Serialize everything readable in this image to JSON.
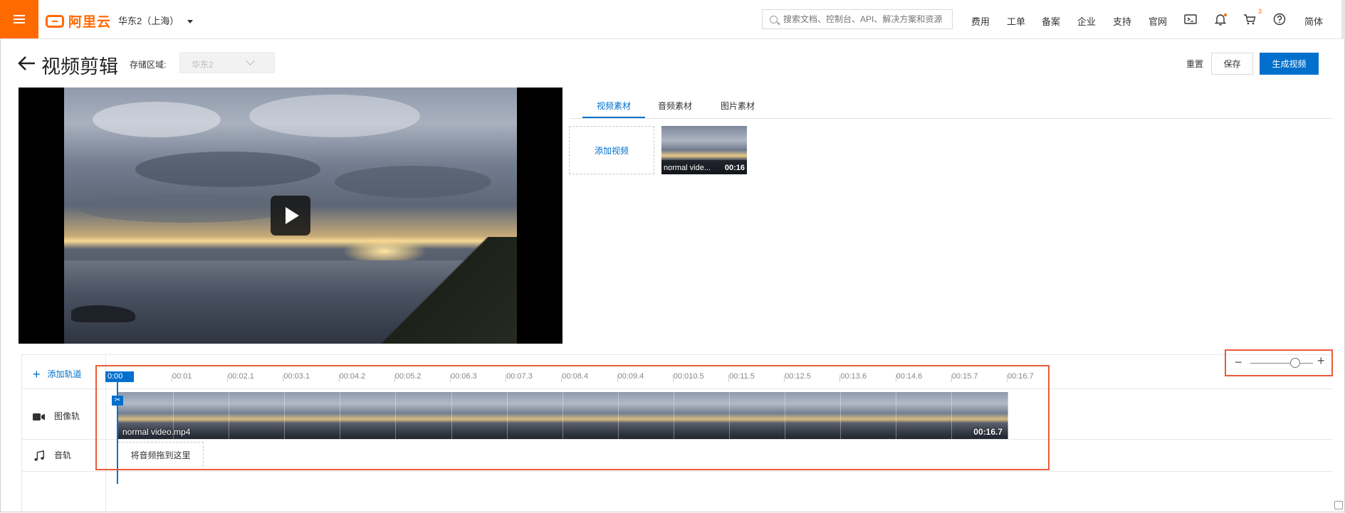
{
  "topbar": {
    "logo_text": "阿里云",
    "region": "华东2（上海）",
    "search_placeholder": "搜索文档、控制台、API、解决方案和资源",
    "nav": [
      "费用",
      "工单",
      "备案",
      "企业",
      "支持",
      "官网"
    ],
    "cart_count": "3",
    "language": "简体",
    "accent_color": "#ff6a00"
  },
  "header": {
    "title": "视频剪辑",
    "storage_label": "存储区域:",
    "storage_value": "华东2",
    "reset_label": "重置",
    "save_label": "保存",
    "generate_label": "生成视频",
    "primary_color": "#0070cc"
  },
  "materials": {
    "tabs": [
      "视频素材",
      "音频素材",
      "图片素材"
    ],
    "active_tab": "视频素材",
    "add_video_label": "添加视频",
    "items": [
      {
        "name": "normal vide...",
        "duration": "00:16"
      }
    ]
  },
  "timeline": {
    "add_track_label": "添加轨道",
    "current_time": "0:00",
    "ticks": [
      "00:01",
      "00:02.1",
      "00:03.1",
      "00:04.2",
      "00:05.2",
      "00:06.3",
      "00:07.3",
      "00:08.4",
      "00:09.4",
      "00:010.5",
      "00:11.5",
      "00:12.5",
      "00:13.6",
      "00:14.6",
      "00:15.7",
      "00:16.7"
    ],
    "tracks": {
      "image_label": "图像轨",
      "audio_label": "音轨"
    },
    "clip": {
      "name": "normal video.mp4",
      "duration": "00:16.7"
    },
    "audio_drop_hint": "将音频拖到这里",
    "zoom_level": 0.72
  }
}
